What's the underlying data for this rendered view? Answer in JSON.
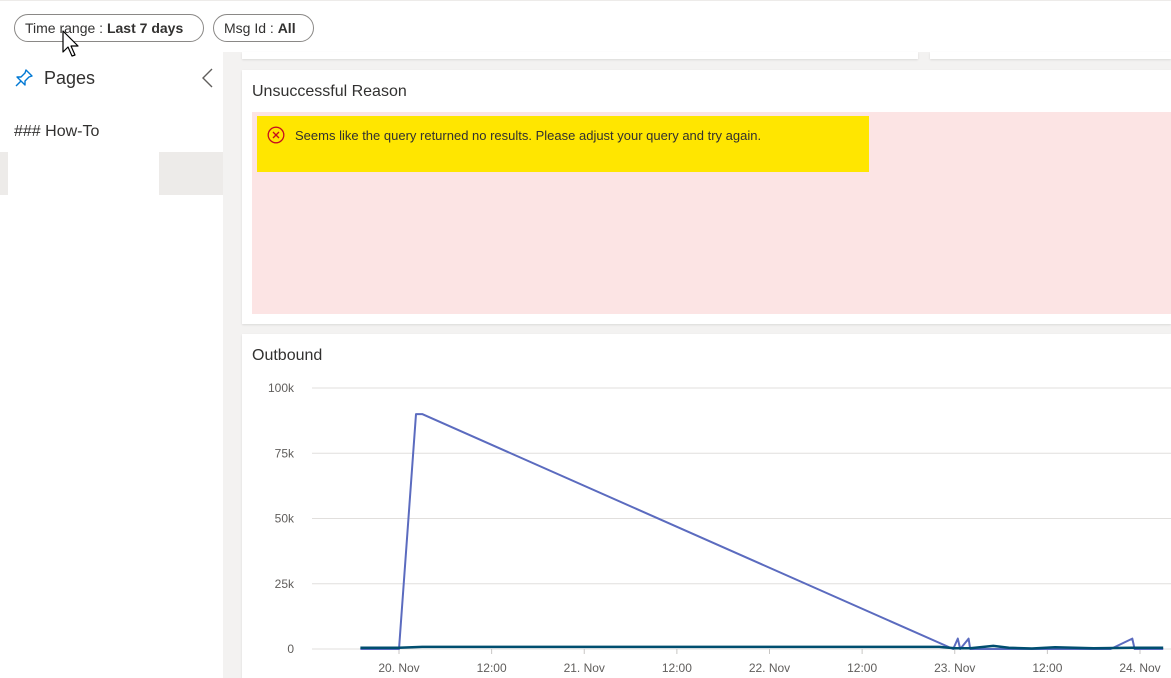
{
  "filters": {
    "time_range": {
      "label": "Time range : ",
      "value": "Last 7 days"
    },
    "msg_id": {
      "label": "Msg Id : ",
      "value": "All"
    }
  },
  "sidebar": {
    "title": "Pages",
    "icon": "pin-icon",
    "items": [
      "### How-To"
    ]
  },
  "tiles": {
    "unsuccessful": {
      "title": "Unsuccessful Reason",
      "error_message": "Seems like the query returned no results. Please adjust your query and try again."
    },
    "outbound": {
      "title": "Outbound"
    }
  },
  "colors": {
    "error_banner": "#ffe600",
    "error_bg": "#fce4e4",
    "series_primary": "#5b6bbf",
    "series_dark": "#004e6f"
  },
  "chart_data": {
    "type": "line",
    "title": "Outbound",
    "xlabel": "",
    "ylabel": "",
    "ylim": [
      0,
      100000
    ],
    "y_ticks": [
      "100k",
      "75k",
      "50k",
      "25k",
      "0"
    ],
    "y_tick_values": [
      100000,
      75000,
      50000,
      25000,
      0
    ],
    "x_ticks": [
      "20. Nov",
      "12:00",
      "21. Nov",
      "12:00",
      "22. Nov",
      "12:00",
      "23. Nov",
      "12:00",
      "24. Nov"
    ],
    "x_tick_hours": [
      0,
      12,
      24,
      36,
      48,
      60,
      72,
      84,
      96
    ],
    "x_range_hours": [
      -5,
      99
    ],
    "grid": true,
    "series": [
      {
        "color": "#5b6bbf",
        "points": [
          [
            -5,
            0
          ],
          [
            0,
            0
          ],
          [
            2.2,
            90000
          ],
          [
            3,
            90000
          ],
          [
            71.8,
            0
          ],
          [
            72.4,
            4000
          ],
          [
            72.7,
            0
          ],
          [
            73.8,
            4000
          ],
          [
            74,
            0
          ],
          [
            92.2,
            0
          ],
          [
            95,
            4000
          ],
          [
            95.3,
            0
          ],
          [
            99,
            0
          ]
        ]
      },
      {
        "color": "#004e6f",
        "points": [
          [
            -5,
            500
          ],
          [
            0,
            500
          ],
          [
            3,
            800
          ],
          [
            70,
            800
          ],
          [
            72,
            300
          ],
          [
            74,
            300
          ],
          [
            77,
            1200
          ],
          [
            79,
            500
          ],
          [
            82,
            200
          ],
          [
            85,
            700
          ],
          [
            90,
            300
          ],
          [
            95,
            500
          ],
          [
            99,
            500
          ]
        ]
      }
    ]
  }
}
